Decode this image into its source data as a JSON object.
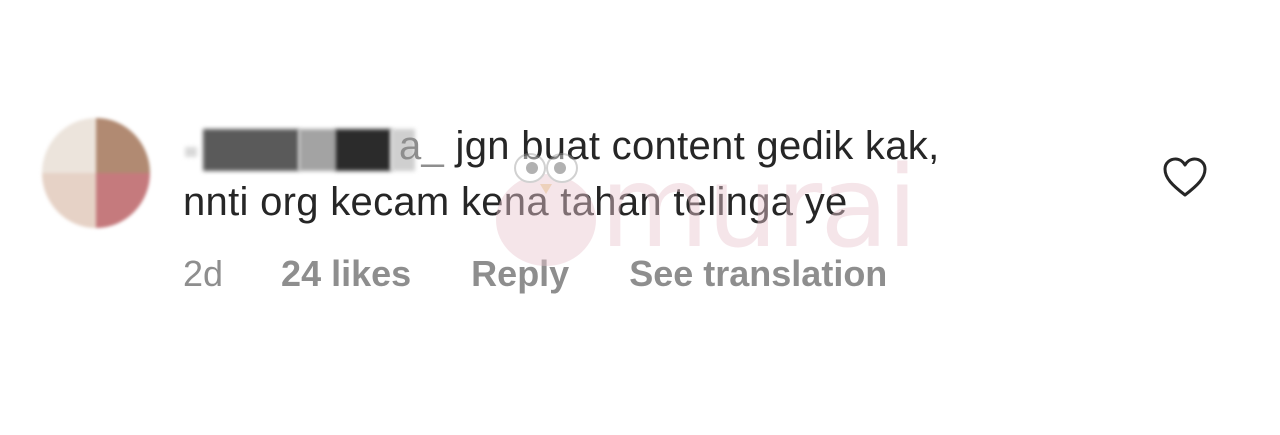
{
  "comment": {
    "username_visible": "a_",
    "text_line1": "jgn buat content gedik kak,",
    "text_line2": "nnti org kecam kena tahan telinga ye",
    "time": "2d",
    "likes": "24 likes",
    "reply_label": "Reply",
    "translate_label": "See translation"
  },
  "watermark": {
    "brand": "murai"
  },
  "icons": {
    "like": "heart-outline-icon",
    "avatar": "avatar"
  },
  "colors": {
    "text": "#262626",
    "secondary": "#8e8e8e",
    "watermark": "#e9c6cf"
  }
}
